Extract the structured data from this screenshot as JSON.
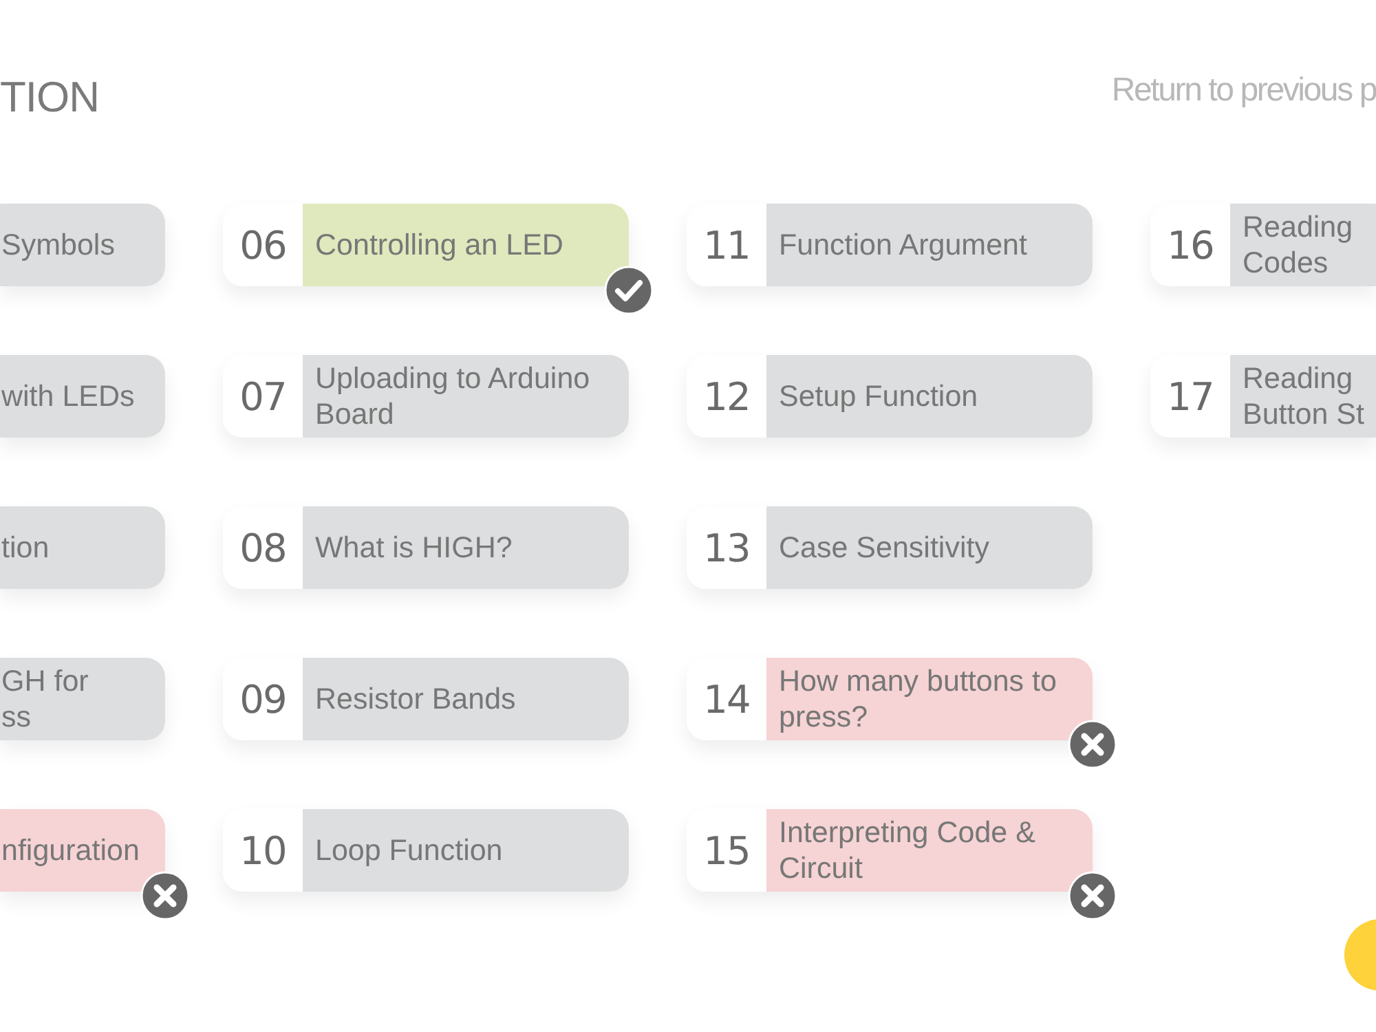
{
  "header": {
    "title": "TION",
    "back_link": "Return to previous p"
  },
  "questions": [
    {
      "lines": [
        "Symbols"
      ],
      "correct": false,
      "wrong": false
    },
    {
      "lines": [
        "with LEDs"
      ],
      "correct": false,
      "wrong": false
    },
    {
      "lines": [
        "tion"
      ],
      "correct": false,
      "wrong": false
    },
    {
      "lines": [
        "GH for",
        "ss"
      ],
      "correct": false,
      "wrong": false
    },
    {
      "lines": [
        "nfiguration"
      ],
      "correct": false,
      "wrong": true
    },
    {
      "number": "06",
      "lines": [
        "Controlling an LED"
      ],
      "correct": true,
      "wrong": false
    },
    {
      "number": "07",
      "lines": [
        "Uploading to Arduino",
        "Board"
      ],
      "correct": false,
      "wrong": false
    },
    {
      "number": "08",
      "lines": [
        "What is HIGH?"
      ],
      "correct": false,
      "wrong": false
    },
    {
      "number": "09",
      "lines": [
        "Resistor Bands"
      ],
      "correct": false,
      "wrong": false
    },
    {
      "number": "10",
      "lines": [
        "Loop Function"
      ],
      "correct": false,
      "wrong": false
    },
    {
      "number": "11",
      "lines": [
        "Function Argument"
      ],
      "correct": false,
      "wrong": false
    },
    {
      "number": "12",
      "lines": [
        "Setup Function"
      ],
      "correct": false,
      "wrong": false
    },
    {
      "number": "13",
      "lines": [
        "Case Sensitivity"
      ],
      "correct": false,
      "wrong": false
    },
    {
      "number": "14",
      "lines": [
        "How many buttons to",
        "press?"
      ],
      "correct": false,
      "wrong": true
    },
    {
      "number": "15",
      "lines": [
        "Interpreting Code &",
        "Circuit"
      ],
      "correct": false,
      "wrong": true
    },
    {
      "number": "16",
      "lines": [
        "Reading",
        "Codes"
      ],
      "correct": false,
      "wrong": false
    },
    {
      "number": "17",
      "lines": [
        "Reading",
        "Button St"
      ],
      "correct": false,
      "wrong": false
    }
  ]
}
